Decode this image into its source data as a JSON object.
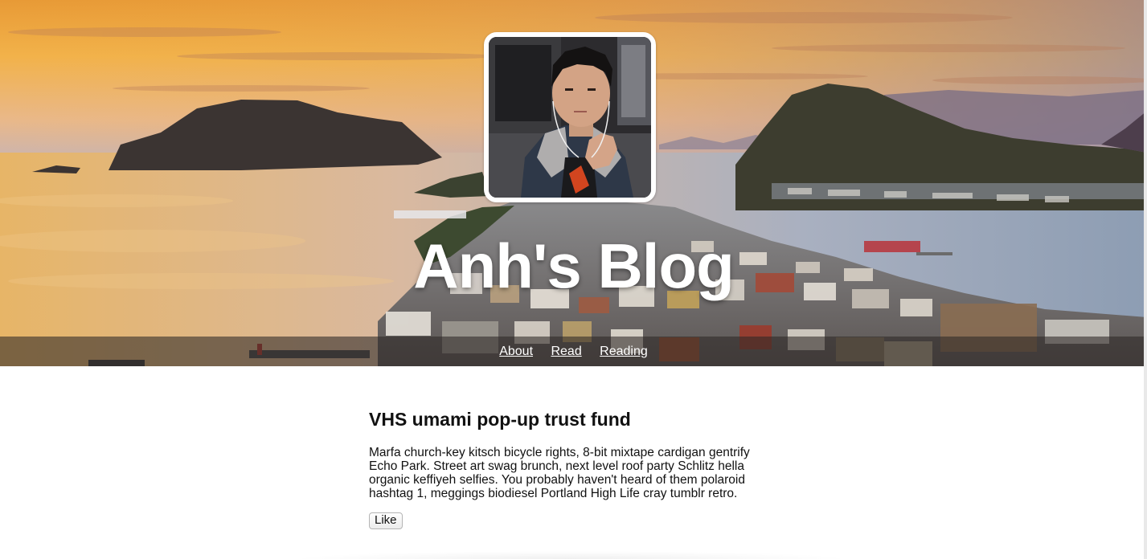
{
  "site": {
    "title": "Anh's Blog"
  },
  "nav": {
    "items": [
      {
        "label": "About"
      },
      {
        "label": "Read"
      },
      {
        "label": "Reading"
      }
    ]
  },
  "post": {
    "title": "VHS umami pop-up trust fund",
    "body": "Marfa church-key kitsch bicycle rights, 8-bit mixtape cardigan gentrify Echo Park. Street art swag brunch, next level roof party Schlitz hella organic keffiyeh selfies. You probably haven't heard of them polaroid hashtag 1, meggings biodiesel Portland High Life cray tumblr retro.",
    "like_label": "Like"
  },
  "colors": {
    "sky_top": "#f3a52a",
    "sky_horizon": "#f7c86a",
    "water": "#9aa7b8",
    "nav_bar": "#2d2826",
    "text": "#111111"
  }
}
